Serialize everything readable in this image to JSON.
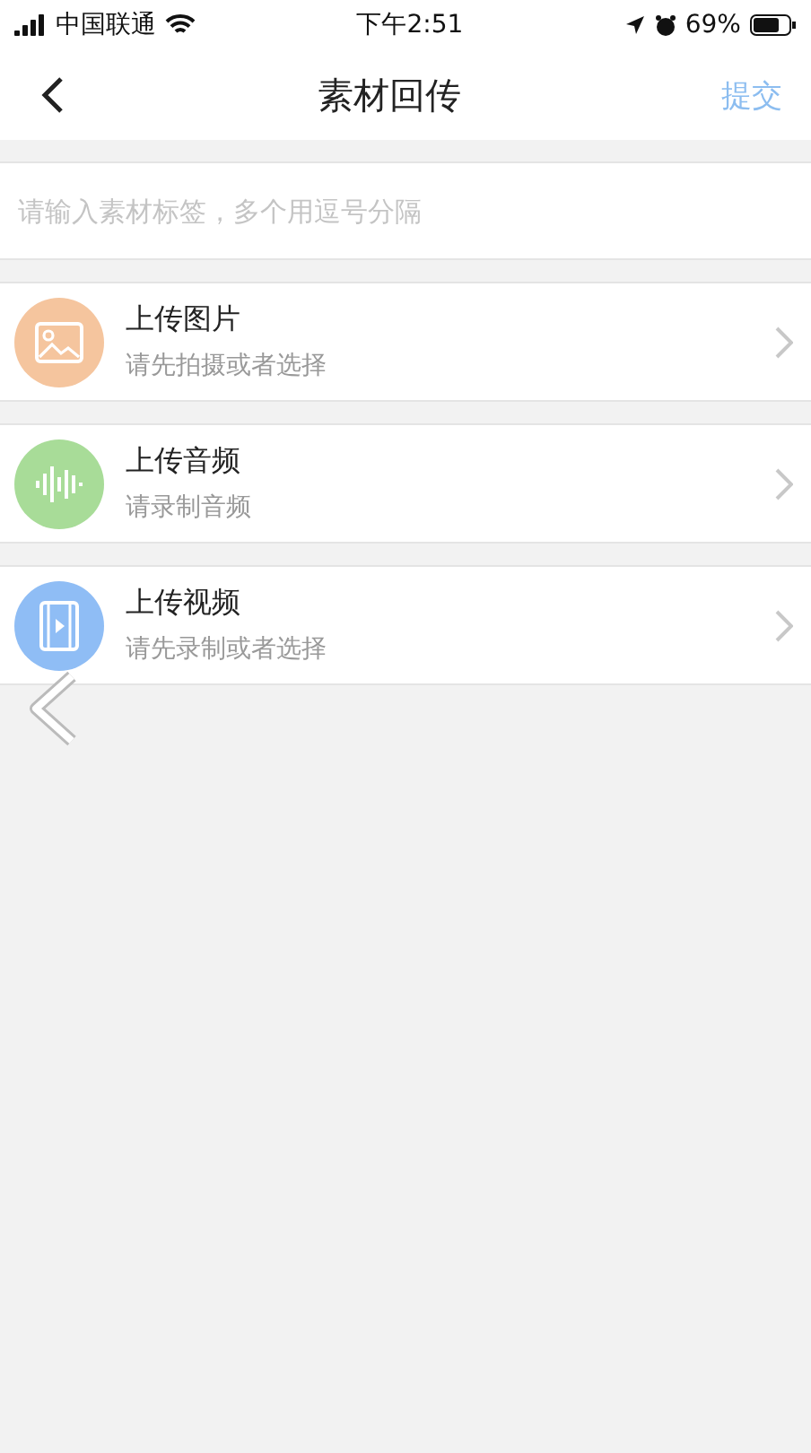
{
  "status_bar": {
    "carrier": "中国联通",
    "time": "下午2:51",
    "battery": "69%"
  },
  "nav": {
    "title": "素材回传",
    "action": "提交"
  },
  "tag_field": {
    "placeholder": "请输入素材标签，多个用逗号分隔"
  },
  "uploads": [
    {
      "kind": "image",
      "title": "上传图片",
      "subtitle": "请先拍摄或者选择",
      "color": "#f5c59e"
    },
    {
      "kind": "audio",
      "title": "上传音频",
      "subtitle": "请录制音频",
      "color": "#a8dc98"
    },
    {
      "kind": "video",
      "title": "上传视频",
      "subtitle": "请先录制或者选择",
      "color": "#8fbdf5"
    }
  ]
}
